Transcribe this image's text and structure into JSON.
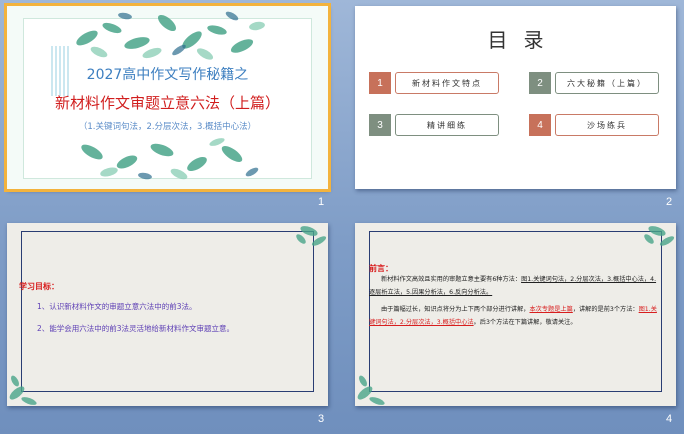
{
  "slides": [
    {
      "number": "1",
      "title_line1": "2027高中作文写作秘籍之",
      "title_line2": "新材料作文审题立意六法（上篇）",
      "subtitle": "（1.关键词句法，2.分层次法，3.概括中心法）"
    },
    {
      "number": "2",
      "toc_title": "目录",
      "items": [
        {
          "index": "1",
          "label": "新材料作文特点",
          "color": "#c7715a"
        },
        {
          "index": "2",
          "label": "六大秘籍（上篇）",
          "color": "#7e8f80"
        },
        {
          "index": "3",
          "label": "精讲细练",
          "color": "#7e8f80"
        },
        {
          "index": "4",
          "label": "沙场练兵",
          "color": "#c7715a"
        }
      ]
    },
    {
      "number": "3",
      "heading": "学习目标：",
      "goals": [
        "1、认识新材料作文的审题立意六法中的前3法。",
        "2、能学会用六法中的前3法灵活地给新材料作文审题立意。"
      ]
    },
    {
      "number": "4",
      "heading": "前言：",
      "p1_a": "新材料作文高效且实用的审题立意主要有6种方法：",
      "p1_b": "图1.关键词句法，2.分层次法，3.概括中心法，4.逐层析立法，5.因果分析法，6.反向分析法。",
      "p2_a": "由于篇幅过长，知识点将分为上下两个部分进行讲解，",
      "p2_b": "本次专题是上篇",
      "p2_c": "，讲解的是前3个方法：",
      "p2_d": "图1.关键词句法，2.分层次法，3.概括中心法",
      "p2_e": "。后3个方法在下篇讲解，敬请关注。"
    }
  ],
  "colors": {
    "accent_red": "#d81e1e",
    "title_blue": "#3d7fc0",
    "frame_navy": "#2a3d73",
    "selection": "#f3b33d"
  }
}
